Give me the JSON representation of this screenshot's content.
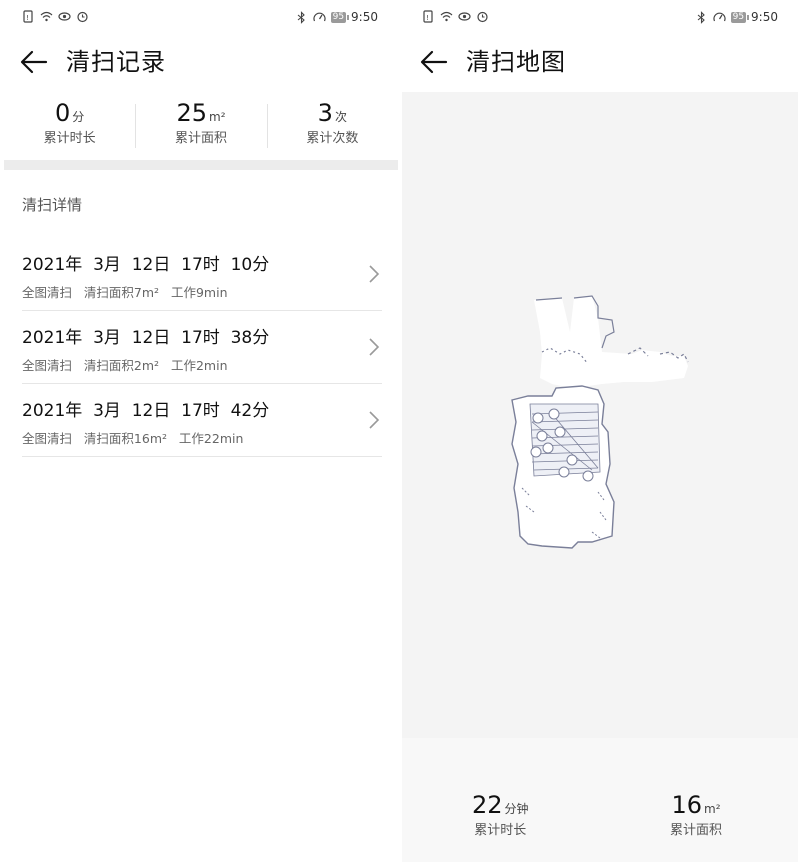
{
  "status_bar": {
    "left_icons": [
      "sim-icon",
      "wifi-icon",
      "eye-icon",
      "alarm-icon"
    ],
    "right_icons": [
      "bluetooth-icon",
      "speed-icon"
    ],
    "battery": "95",
    "time": "9:50"
  },
  "records_screen": {
    "title": "清扫记录",
    "stats": [
      {
        "value": "0",
        "unit": "分",
        "label": "累计时长"
      },
      {
        "value": "25",
        "unit": "m²",
        "label": "累计面积"
      },
      {
        "value": "3",
        "unit": "次",
        "label": "累计次数"
      }
    ],
    "section_title": "清扫详情",
    "records": [
      {
        "date": "2021年  3月  12日  17时  10分",
        "detail": "全图清扫   清扫面积7m²   工作9min"
      },
      {
        "date": "2021年  3月  12日  17时  38分",
        "detail": "全图清扫   清扫面积2m²   工作2min"
      },
      {
        "date": "2021年  3月  12日  17时  42分",
        "detail": "全图清扫   清扫面积16m²   工作22min"
      }
    ]
  },
  "map_screen": {
    "title": "清扫地图",
    "stats": [
      {
        "value": "22",
        "unit": "分钟",
        "label": "累计时长"
      },
      {
        "value": "16",
        "unit": "m²",
        "label": "累计面积"
      }
    ]
  },
  "colors": {
    "accent": "#111111",
    "map_background": "#f4f4f4",
    "map_outline": "#7a7f99"
  }
}
